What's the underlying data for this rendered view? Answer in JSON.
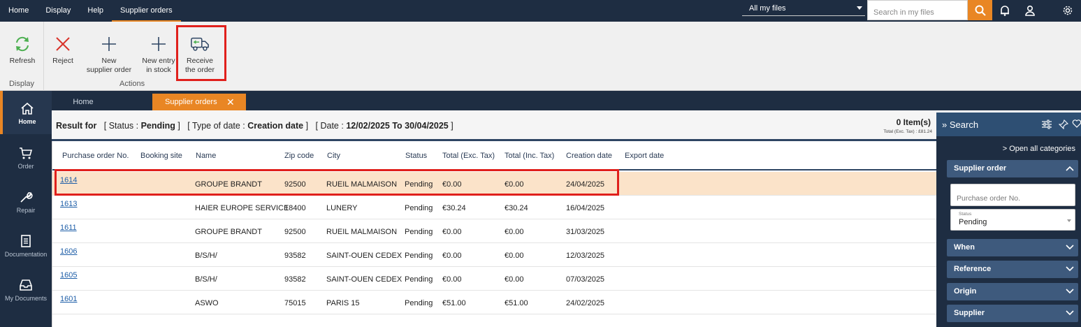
{
  "topbar": {
    "menu": [
      "Home",
      "Display",
      "Help",
      "Supplier orders"
    ],
    "files_select": "All my files",
    "search_placeholder": "Search in my files"
  },
  "ribbon": {
    "display_group": {
      "label": "Display",
      "refresh": "Refresh"
    },
    "actions_group": {
      "label": "Actions",
      "reject": "Reject",
      "new_supplier_order_l1": "New",
      "new_supplier_order_l2": "supplier order",
      "new_entry_l1": "New entry",
      "new_entry_l2": "in stock",
      "receive_l1": "Receive",
      "receive_l2": "the order"
    }
  },
  "leftnav": [
    "Home",
    "Order",
    "Repair",
    "Documentation",
    "My Documents"
  ],
  "tabs": [
    "Home",
    "Supplier orders"
  ],
  "result": {
    "prefix": "Result for",
    "status_label": "[ Status :",
    "status_value": "Pending",
    "status_close": "]",
    "type_label": "[ Type of date :",
    "type_value": "Creation date",
    "type_close": "]",
    "date_label": "[ Date :",
    "date_value": "12/02/2025 To 30/04/2025",
    "date_close": "]",
    "items": "0 Item(s)",
    "total": "Total (Exc. Tax) : £81.24"
  },
  "table": {
    "headers": [
      "Purchase order No.",
      "Booking site",
      "Name",
      "Zip code",
      "City",
      "Status",
      "Total (Exc. Tax)",
      "Total (Inc. Tax)",
      "Creation date",
      "Export date"
    ],
    "rows": [
      {
        "po": "1614",
        "site": "",
        "name": "GROUPE BRANDT",
        "zip": "92500",
        "city": "RUEIL MALMAISON",
        "status": "Pending",
        "exc": "€0.00",
        "inc": "€0.00",
        "created": "24/04/2025",
        "export": ""
      },
      {
        "po": "1613",
        "site": "",
        "name": "HAIER EUROPE SERVICE",
        "zip": "18400",
        "city": "LUNERY",
        "status": "Pending",
        "exc": "€30.24",
        "inc": "€30.24",
        "created": "16/04/2025",
        "export": ""
      },
      {
        "po": "1611",
        "site": "",
        "name": "GROUPE BRANDT",
        "zip": "92500",
        "city": "RUEIL MALMAISON",
        "status": "Pending",
        "exc": "€0.00",
        "inc": "€0.00",
        "created": "31/03/2025",
        "export": ""
      },
      {
        "po": "1606",
        "site": "",
        "name": "B/S/H/",
        "zip": "93582",
        "city": "SAINT-OUEN CEDEX",
        "status": "Pending",
        "exc": "€0.00",
        "inc": "€0.00",
        "created": "12/03/2025",
        "export": ""
      },
      {
        "po": "1605",
        "site": "",
        "name": "B/S/H/",
        "zip": "93582",
        "city": "SAINT-OUEN CEDEX",
        "status": "Pending",
        "exc": "€0.00",
        "inc": "€0.00",
        "created": "07/03/2025",
        "export": ""
      },
      {
        "po": "1601",
        "site": "",
        "name": "ASWO",
        "zip": "75015",
        "city": "PARIS 15",
        "status": "Pending",
        "exc": "€51.00",
        "inc": "€51.00",
        "created": "24/02/2025",
        "export": ""
      }
    ]
  },
  "search_panel": {
    "title": "Search",
    "open_all": "Open all categories",
    "supplier_order": "Supplier order",
    "po_placeholder": "Purchase order No.",
    "status_label": "Status",
    "status_value": "Pending",
    "sections": [
      "When",
      "Reference",
      "Origin",
      "Supplier"
    ]
  },
  "colors": {
    "accent": "#e98624",
    "navy": "#1e2d42",
    "highlight": "#e0201c",
    "selected_row": "#fbe3c9"
  }
}
